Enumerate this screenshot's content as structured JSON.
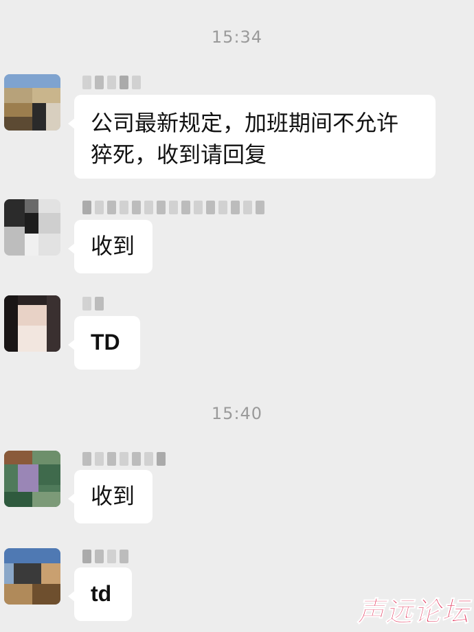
{
  "timestamps": [
    "15:34",
    "15:40"
  ],
  "messages": [
    {
      "avatar": "pixelated-avatar-landscape",
      "text": "公司最新规定，加班期间不允许\n猝死，收到请回复"
    },
    {
      "avatar": "pixelated-avatar-dark",
      "text": "收到"
    },
    {
      "avatar": "pixelated-avatar-girl",
      "text": "TD"
    },
    {
      "avatar": "pixelated-avatar-green",
      "text": "收到"
    },
    {
      "avatar": "pixelated-avatar-blue",
      "text": "td"
    }
  ],
  "watermark": "声远论坛",
  "colors": {
    "background": "#ededed",
    "bubble": "#ffffff",
    "timestamp": "#9a9a9a",
    "watermark": "#e0264f"
  }
}
